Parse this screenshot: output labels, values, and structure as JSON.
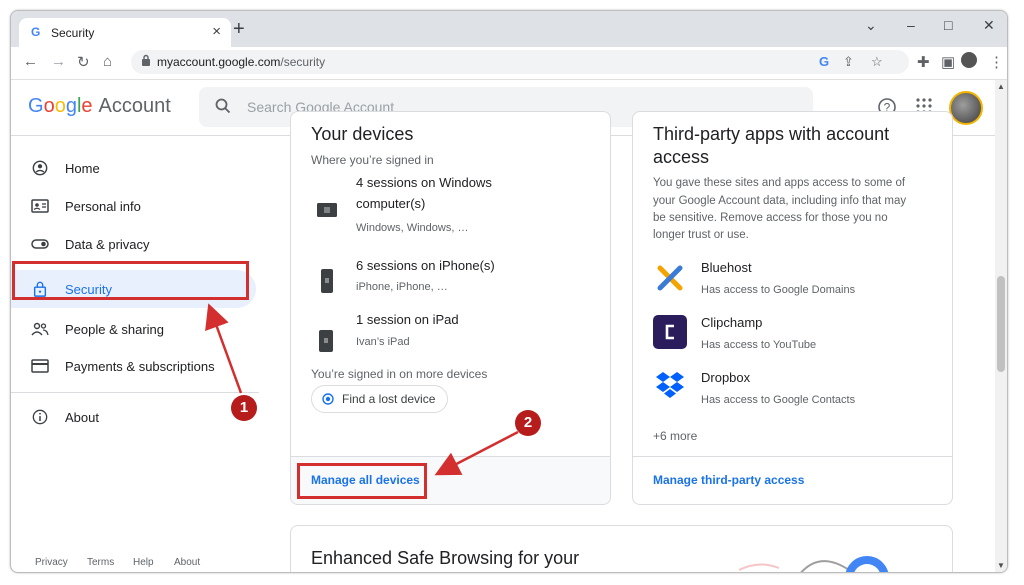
{
  "browser": {
    "tab": {
      "title": "Security",
      "favicon": "G"
    },
    "new_tab": "+",
    "window_controls": [
      "⌄",
      "–",
      "□",
      "✕"
    ],
    "url": {
      "host": "myaccount.google.com",
      "path": "/security"
    }
  },
  "header": {
    "logo_letters": [
      "G",
      "o",
      "o",
      "g",
      "l",
      "e"
    ],
    "product": "Account",
    "search_placeholder": "Search Google Account"
  },
  "sidebar": {
    "items": [
      {
        "label": "Home",
        "icon": "home-icon"
      },
      {
        "label": "Personal info",
        "icon": "id-card-icon"
      },
      {
        "label": "Data & privacy",
        "icon": "toggle-icon"
      },
      {
        "label": "Security",
        "icon": "lock-icon",
        "active": true
      },
      {
        "label": "People & sharing",
        "icon": "people-icon"
      },
      {
        "label": "Payments & subscriptions",
        "icon": "card-icon"
      },
      {
        "label": "About",
        "icon": "info-icon"
      }
    ],
    "footer": [
      "Privacy",
      "Terms",
      "Help",
      "About"
    ]
  },
  "devices_card": {
    "title": "Your devices",
    "signed_in_label": "Where you’re signed in",
    "devices": [
      {
        "title": "4 sessions on Windows computer(s)",
        "title_line1": "4 sessions on Windows",
        "title_line2": "computer(s)",
        "subtitle": "Windows, Windows, …"
      },
      {
        "title": "6 sessions on iPhone(s)",
        "subtitle": "iPhone, iPhone, …"
      },
      {
        "title": "1 session on iPad",
        "subtitle": "Ivan’s iPad"
      }
    ],
    "more_devices": "You’re signed in on more devices",
    "find_device": "Find a lost device",
    "manage": "Manage all devices"
  },
  "apps_card": {
    "title_line1": "Third-party apps with account",
    "title_line2": "access",
    "description": "You gave these sites and apps access to some of your Google Account data, including info that may be sensitive. Remove access for those you no longer trust or use.",
    "description_lines": [
      "You gave these sites and apps access to some of",
      "your Google Account data, including info that may",
      "be sensitive. Remove access for those you no",
      "longer trust or use."
    ],
    "apps": [
      {
        "name": "Bluehost",
        "access": "Has access to Google Domains",
        "icon": "bluehost-icon"
      },
      {
        "name": "Clipchamp",
        "access": "Has access to YouTube",
        "icon": "clipchamp-icon"
      },
      {
        "name": "Dropbox",
        "access": "Has access to Google Contacts",
        "icon": "dropbox-icon"
      }
    ],
    "more": "+6 more",
    "manage": "Manage third-party access"
  },
  "safe_browsing_card": {
    "title": "Enhanced Safe Browsing for your"
  },
  "annotations": {
    "step1": "1",
    "step2": "2",
    "color": "#d32f2f"
  }
}
